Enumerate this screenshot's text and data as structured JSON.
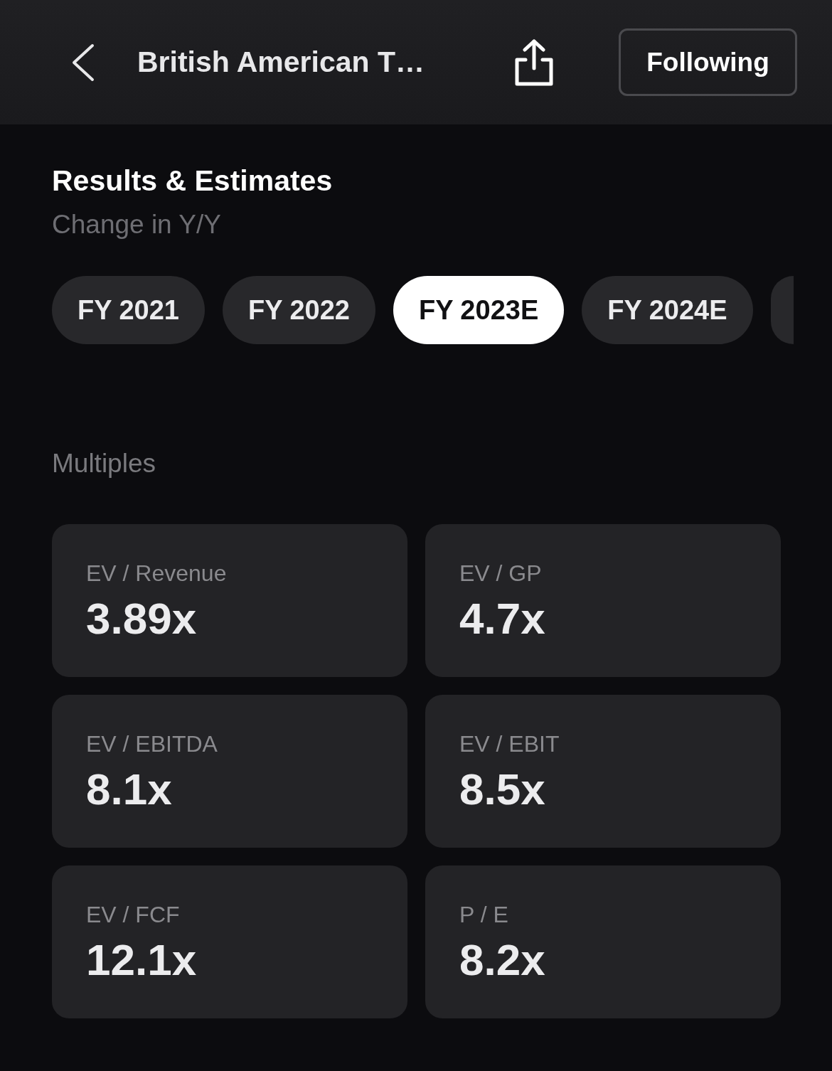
{
  "header": {
    "title": "British American T…",
    "follow_button": {
      "label": "Following"
    }
  },
  "section": {
    "title": "Results & Estimates",
    "subtitle": "Change in Y/Y"
  },
  "tabs": [
    {
      "label": "FY 2021",
      "selected": false
    },
    {
      "label": "FY 2022",
      "selected": false
    },
    {
      "label": "FY 2023E",
      "selected": true
    },
    {
      "label": "FY 2024E",
      "selected": false
    },
    {
      "selected": false
    }
  ],
  "multiples": {
    "title": "Multiples",
    "cards": [
      {
        "label": "EV / Revenue",
        "value": "3.89x"
      },
      {
        "label": "EV / GP",
        "value": "4.7x"
      },
      {
        "label": "EV / EBITDA",
        "value": "8.1x"
      },
      {
        "label": "EV / EBIT",
        "value": "8.5x"
      },
      {
        "label": "EV / FCF",
        "value": "12.1x"
      },
      {
        "label": "P / E",
        "value": "8.2x"
      }
    ]
  }
}
